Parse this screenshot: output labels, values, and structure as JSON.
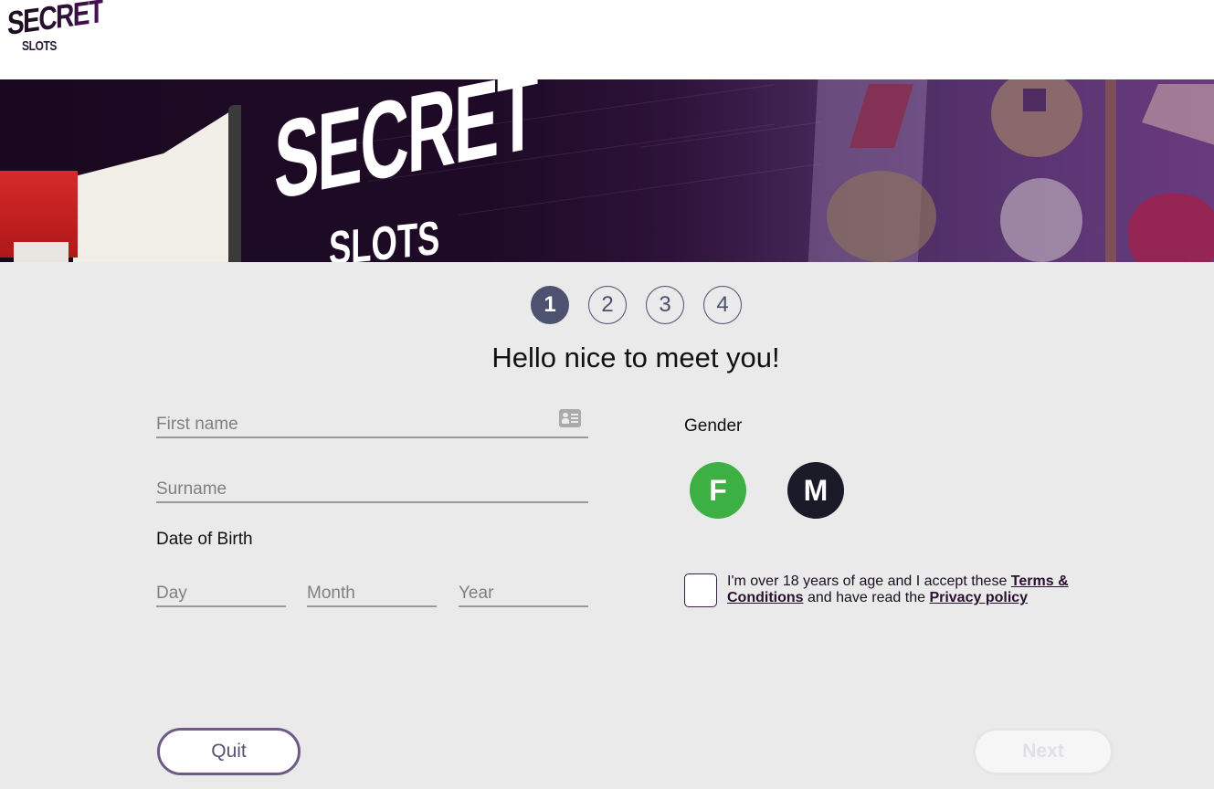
{
  "header": {
    "logo_line1": "SECRET",
    "logo_line2": "SLOTS"
  },
  "banner": {
    "title": "SECRET",
    "subtitle": "SLOTS"
  },
  "steps": [
    {
      "label": "1",
      "active": true
    },
    {
      "label": "2",
      "active": false
    },
    {
      "label": "3",
      "active": false
    },
    {
      "label": "4",
      "active": false
    }
  ],
  "form": {
    "title": "Hello nice to meet you!",
    "first_name": {
      "placeholder": "First name",
      "value": ""
    },
    "surname": {
      "placeholder": "Surname",
      "value": ""
    },
    "dob_label": "Date of Birth",
    "day": {
      "placeholder": "Day",
      "value": ""
    },
    "month": {
      "placeholder": "Month",
      "value": ""
    },
    "year": {
      "placeholder": "Year",
      "value": ""
    },
    "gender_label": "Gender",
    "gender_options": [
      {
        "label": "F",
        "color": "#3cb043"
      },
      {
        "label": "M",
        "color": "#1a1a28"
      }
    ],
    "consent": {
      "checked": false,
      "text_before": "I'm over 18 years of age and I accept these ",
      "terms_link": "Terms & Conditions",
      "text_middle": " and have read the ",
      "privacy_link": "Privacy policy"
    }
  },
  "buttons": {
    "quit": "Quit",
    "next": "Next"
  },
  "colors": {
    "accent": "#4d5270",
    "brand_purple": "#6e5a88",
    "female": "#3cb043",
    "male": "#1a1a28"
  }
}
